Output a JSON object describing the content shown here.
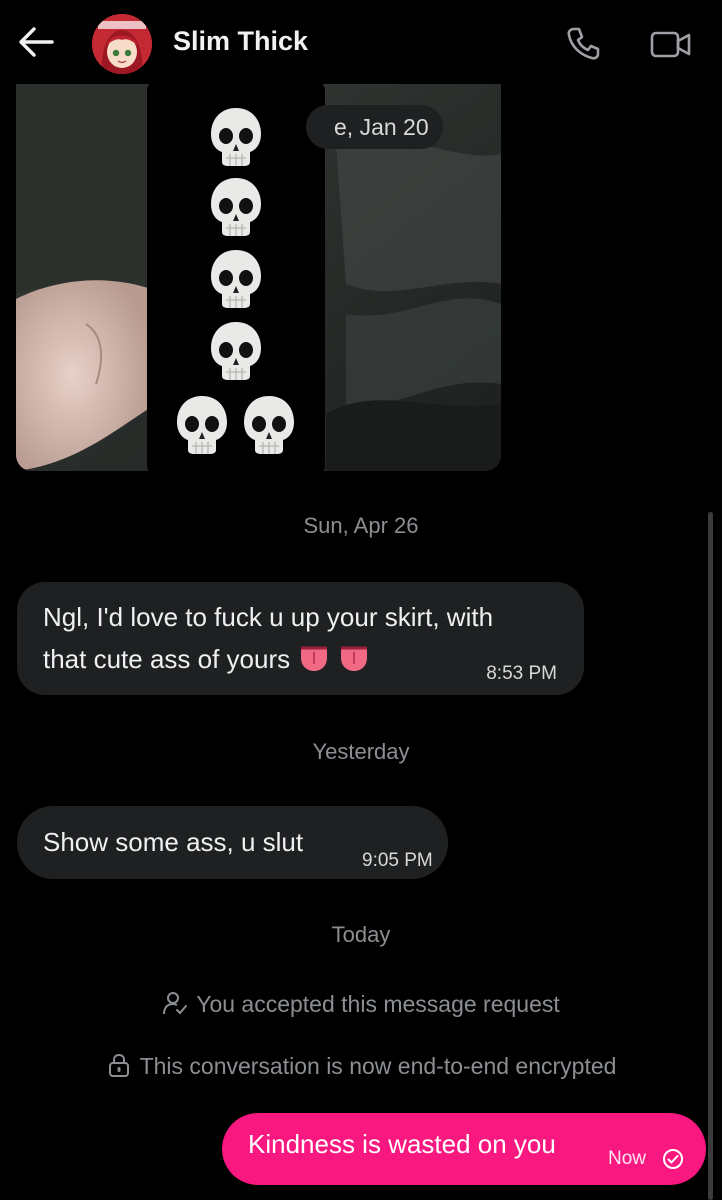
{
  "header": {
    "title": "Slim Thick",
    "back_icon": "arrow-left-icon",
    "phone_icon": "phone-icon",
    "video_icon": "video-camera-icon"
  },
  "media": {
    "date_chip": "e, Jan 20",
    "skull_count": 6
  },
  "separators": {
    "s1": "Sun, Apr 26",
    "s2": "Yesterday",
    "s3": "Today"
  },
  "messages": [
    {
      "line1": "Ngl, I'd love to fuck u up your skirt, with",
      "line2": "that cute ass of yours",
      "time": "8:53 PM"
    },
    {
      "text": "Show some ass, u slut",
      "time": "9:05 PM"
    }
  ],
  "system": {
    "accepted": "You accepted this message request",
    "encrypted": "This conversation is now end-to-end encrypted"
  },
  "outgoing": {
    "text": "Kindness is wasted on you",
    "time": "Now"
  },
  "colors": {
    "accent": "#f91880",
    "bubble": "#1f2021",
    "muted": "#8b8f93"
  }
}
